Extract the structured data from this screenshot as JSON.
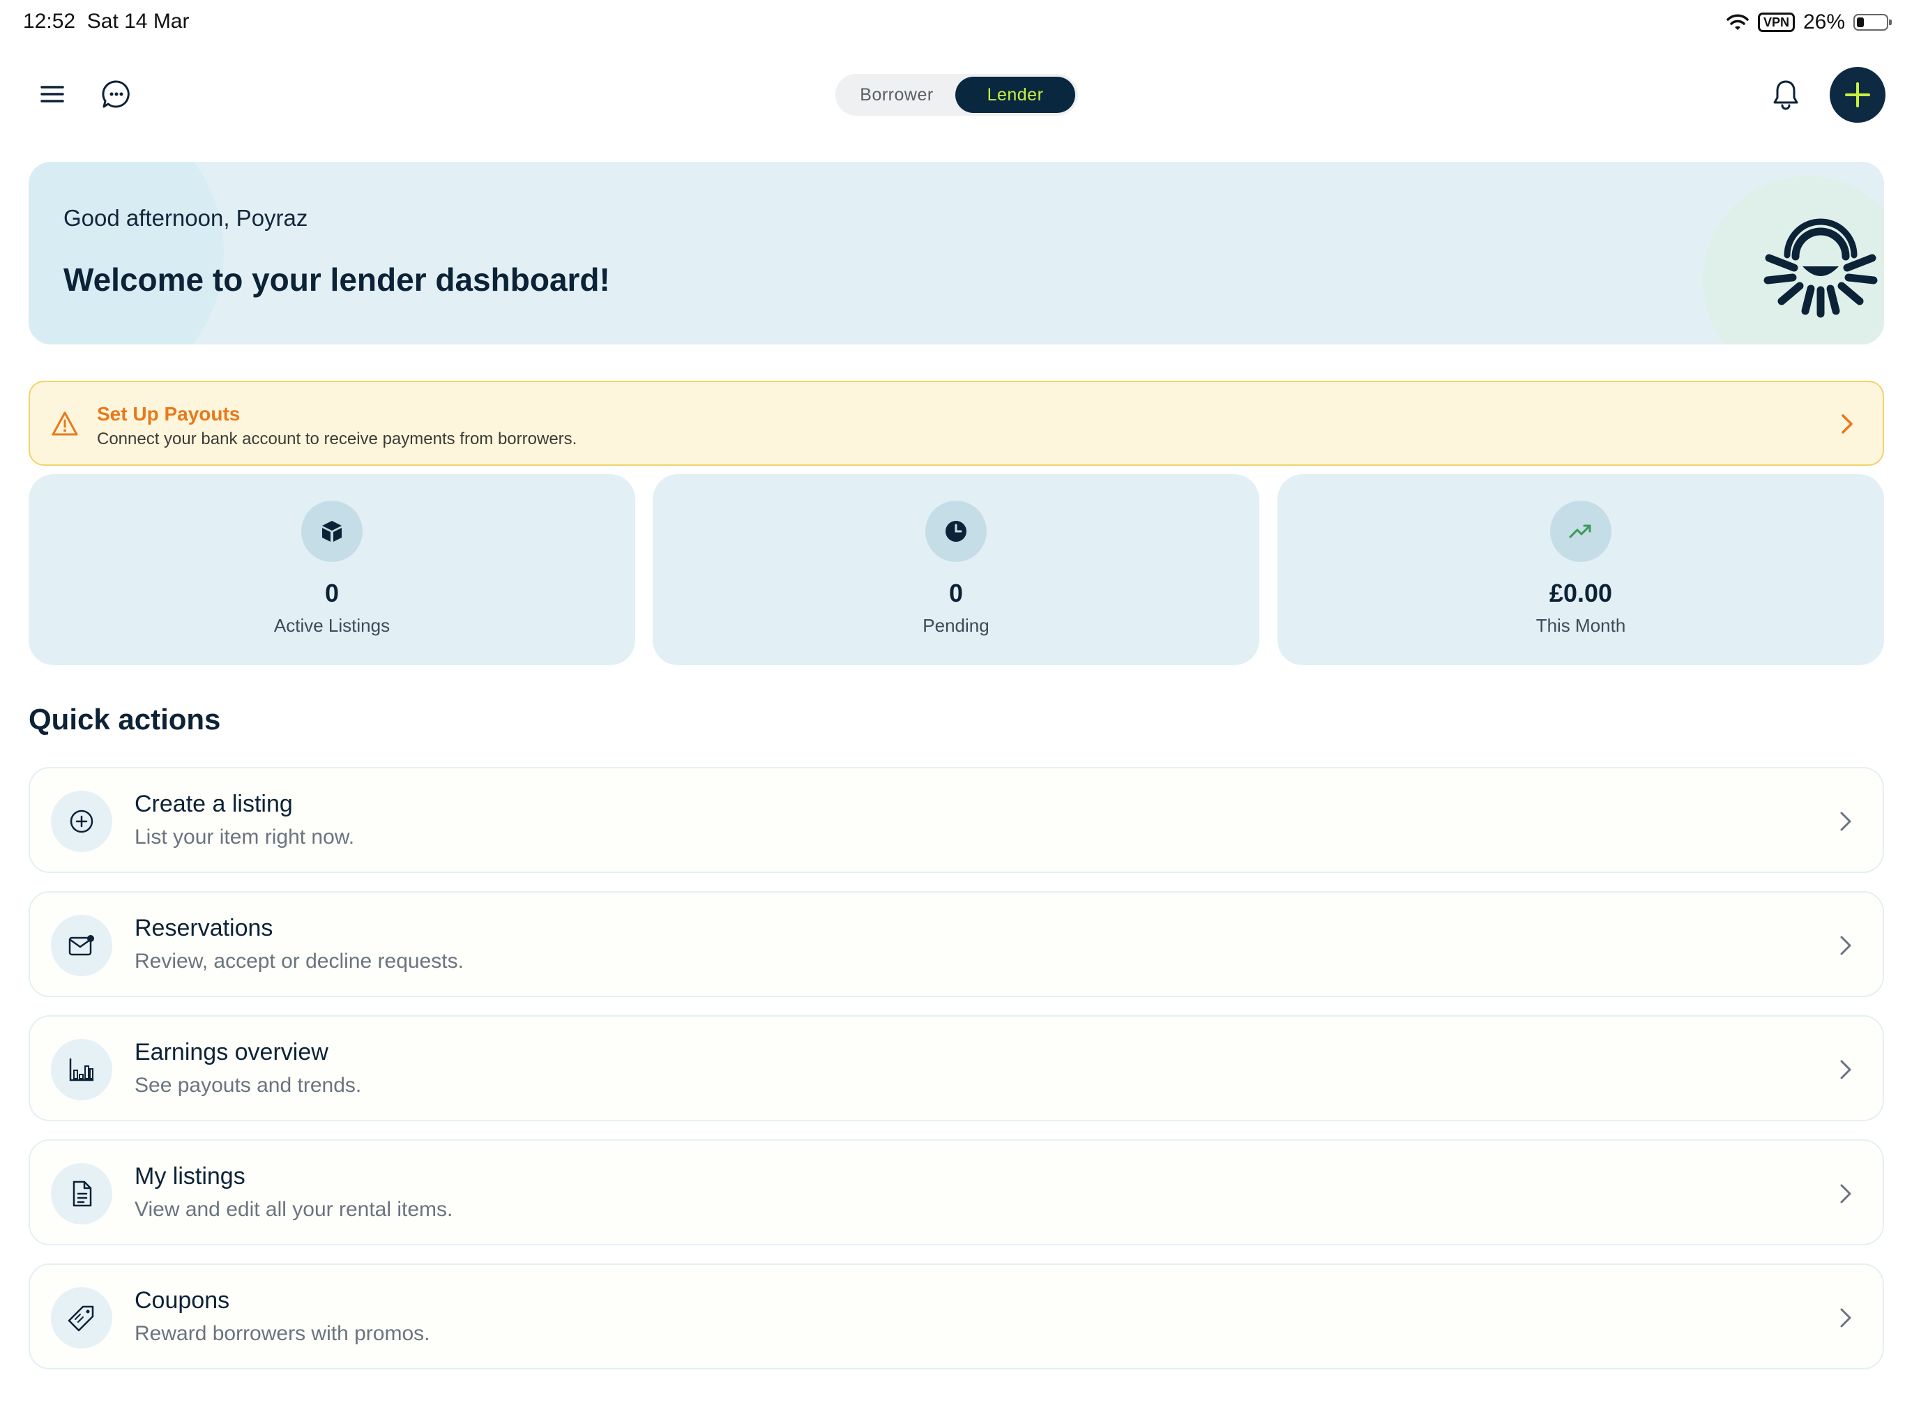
{
  "status_bar": {
    "time": "12:52",
    "date": "Sat 14 Mar",
    "vpn": "VPN",
    "battery": "26%"
  },
  "header": {
    "mode_toggle": {
      "borrower": "Borrower",
      "lender": "Lender",
      "selected": "Lender"
    },
    "accent_color": "#c8f03c",
    "brand_color": "#0a2740"
  },
  "banner": {
    "greeting": "Good afternoon, Poyraz",
    "title": "Welcome to your lender dashboard!"
  },
  "payout_alert": {
    "title": "Set Up Payouts",
    "description": "Connect your bank account to receive payments from borrowers."
  },
  "stats": [
    {
      "icon": "box-icon",
      "value": "0",
      "label": "Active Listings"
    },
    {
      "icon": "clock-icon",
      "value": "0",
      "label": "Pending"
    },
    {
      "icon": "trending-up-icon",
      "value": "£0.00",
      "label": "This Month"
    }
  ],
  "quick_actions": {
    "title": "Quick actions",
    "items": [
      {
        "icon": "plus-circle-icon",
        "label": "Create a listing",
        "description": "List your item right now."
      },
      {
        "icon": "mail-notification-icon",
        "label": "Reservations",
        "description": "Review, accept or decline requests."
      },
      {
        "icon": "bar-chart-icon",
        "label": "Earnings overview",
        "description": "See payouts and trends."
      },
      {
        "icon": "document-icon",
        "label": "My listings",
        "description": "View and edit all your rental items."
      },
      {
        "icon": "tag-icon",
        "label": "Coupons",
        "description": "Reward borrowers with promos."
      }
    ]
  }
}
